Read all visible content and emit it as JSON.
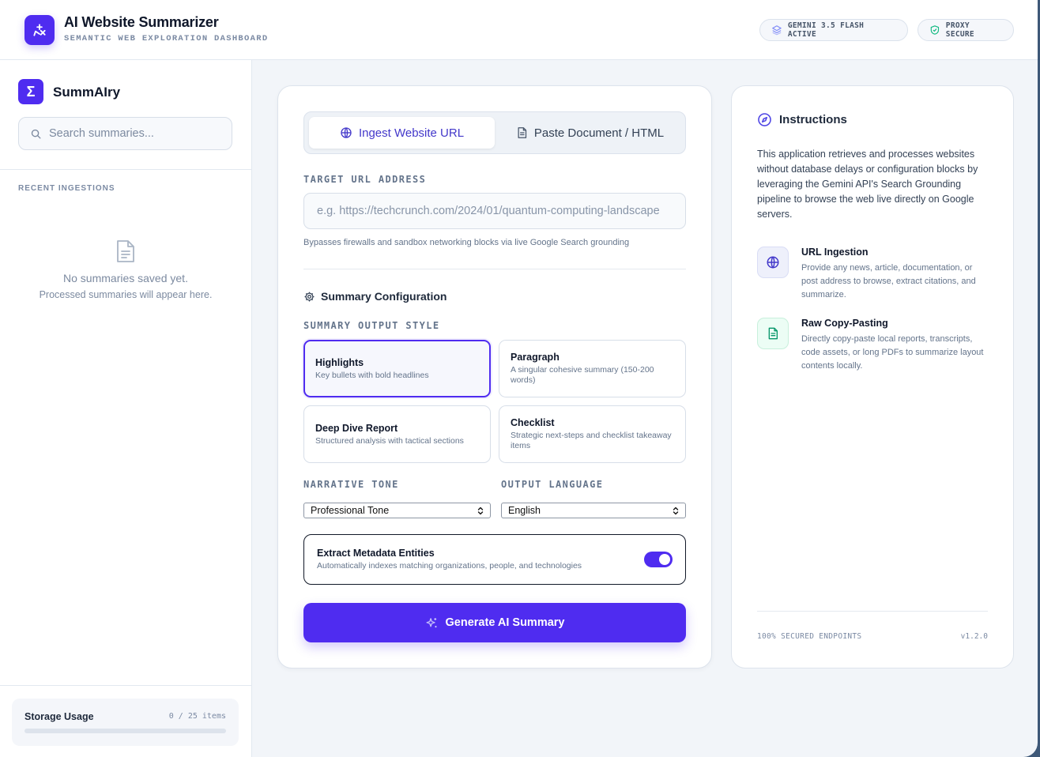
{
  "header": {
    "title": "AI Website Summarizer",
    "subtitle": "SEMANTIC WEB EXPLORATION DASHBOARD",
    "badge_model": "GEMINI 3.5 FLASH ACTIVE",
    "badge_proxy": "PROXY SECURE"
  },
  "sidebar": {
    "brand": "SummAIry",
    "brand_symbol": "Σ",
    "search_placeholder": "Search summaries...",
    "recent_label": "RECENT INGESTIONS",
    "empty_title": "No summaries saved yet.",
    "empty_subtitle": "Processed summaries will appear here.",
    "storage_label": "Storage Usage",
    "storage_count": "0 / 25 items",
    "storage_fraction": 0
  },
  "main": {
    "tabs": [
      {
        "label": "Ingest Website URL",
        "active": true
      },
      {
        "label": "Paste Document / HTML",
        "active": false
      }
    ],
    "url_label": "TARGET URL ADDRESS",
    "url_placeholder": "e.g. https://techcrunch.com/2024/01/quantum-computing-landscape",
    "url_value": "",
    "url_hint": "Bypasses firewalls and sandbox networking blocks via live Google Search grounding",
    "config_title": "Summary Configuration",
    "style_label": "SUMMARY OUTPUT STYLE",
    "styles": [
      {
        "title": "Highlights",
        "desc": "Key bullets with bold headlines",
        "selected": true
      },
      {
        "title": "Paragraph",
        "desc": "A singular cohesive summary (150-200 words)",
        "selected": false
      },
      {
        "title": "Deep Dive Report",
        "desc": "Structured analysis with tactical sections",
        "selected": false
      },
      {
        "title": "Checklist",
        "desc": "Strategic next-steps and checklist takeaway items",
        "selected": false
      }
    ],
    "tone_label": "NARRATIVE TONE",
    "tone_value": "Professional Tone",
    "language_label": "OUTPUT LANGUAGE",
    "language_value": "English",
    "metadata_title": "Extract Metadata Entities",
    "metadata_desc": "Automatically indexes matching organizations, people, and technologies",
    "metadata_enabled": true,
    "generate_label": "Generate AI Summary"
  },
  "instructions": {
    "title": "Instructions",
    "body": "This application retrieves and processes websites without database delays or configuration blocks by leveraging the Gemini API's Search Grounding pipeline to browse the web live directly on Google servers.",
    "features": [
      {
        "title": "URL Ingestion",
        "desc": "Provide any news, article, documentation, or post address to browse, extract citations, and summarize.",
        "icon": "globe-icon"
      },
      {
        "title": "Raw Copy-Pasting",
        "desc": "Directly copy-paste local reports, transcripts, code assets, or long PDFs to summarize layout contents locally.",
        "icon": "document-icon"
      }
    ],
    "footer_left": "100% SECURED ENDPOINTS",
    "footer_right": "v1.2.0"
  },
  "colors": {
    "accent": "#4f2cf0",
    "success": "#059669"
  }
}
